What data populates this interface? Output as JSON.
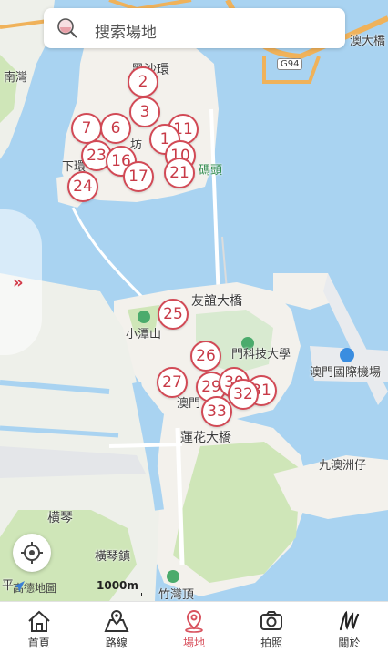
{
  "search": {
    "placeholder_text": "搜索場地"
  },
  "map": {
    "labels": {
      "hei_sha_wan": "黑沙環",
      "xia_huan": "下環",
      "ma_tou": "碼頭",
      "xin_kou": "坊",
      "nan_wan": "南灣",
      "bridge_top_right": "澳大橋",
      "road_code": "G94",
      "friendship_bridge": "友誼大橋",
      "xiao_tan_shan": "小潭山",
      "university": "門科技大學",
      "airport": "澳門國際機場",
      "aomen": "澳門",
      "lotus_bridge": "蓮花大橋",
      "jiu_ao": "九澳洲仔",
      "hengqin": "橫琴",
      "hengqin_town": "橫琴鎮",
      "zhu_wan_ding": "竹灣頂",
      "left_edge_ping": "平"
    },
    "markers": [
      "2",
      "3",
      "7",
      "6",
      "11",
      "1",
      "23",
      "16",
      "10",
      "21",
      "17",
      "24",
      "25",
      "26",
      "27",
      "29",
      "30",
      "31",
      "32",
      "33"
    ],
    "attribution": "高德地圖",
    "scale_label": "1000m"
  },
  "tabs": [
    {
      "label": "首頁",
      "icon": "home-icon",
      "active": false
    },
    {
      "label": "路線",
      "icon": "route-map-icon",
      "active": false
    },
    {
      "label": "場地",
      "icon": "location-pin-icon",
      "active": true
    },
    {
      "label": "拍照",
      "icon": "camera-icon",
      "active": false
    },
    {
      "label": "關於",
      "icon": "signature-icon",
      "active": false
    }
  ],
  "colors": {
    "accent": "#d23a48",
    "water": "#a9d3f1",
    "land": "#f3f1ec",
    "park": "#cfe6b8"
  }
}
